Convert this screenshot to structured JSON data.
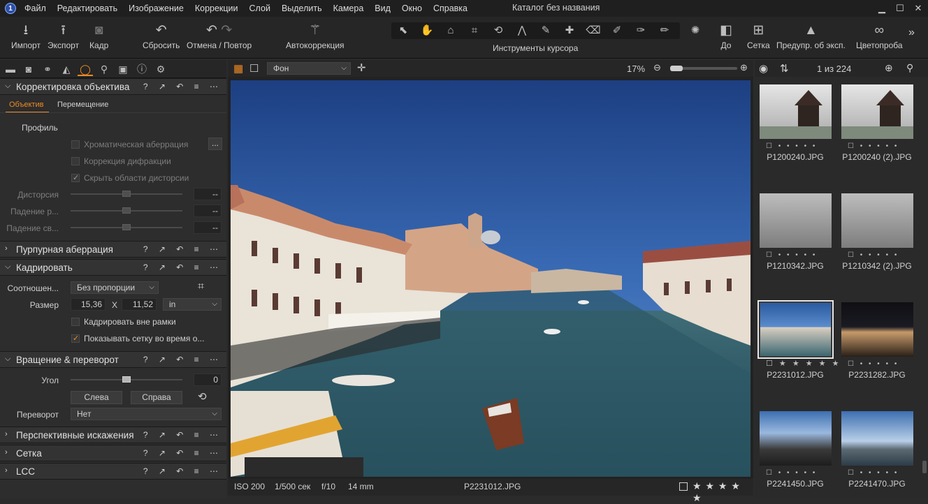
{
  "app": {
    "title": "Каталог без названия",
    "logo": "1"
  },
  "menu": [
    "Файл",
    "Редактировать",
    "Изображение",
    "Коррекции",
    "Слой",
    "Выделить",
    "Камера",
    "Вид",
    "Окно",
    "Справка"
  ],
  "toolbar": {
    "import": "Импорт",
    "export": "Экспорт",
    "capture": "Кадр",
    "reset": "Сбросить",
    "undo_redo": "Отмена / Повтор",
    "autocorrect": "Автокоррекция",
    "cursor_tools": "Инструменты курсора",
    "before": "До",
    "grid": "Сетка",
    "exposure_warning": "Предупр. об эксп.",
    "color_picker": "Цветопроба"
  },
  "left": {
    "lens": {
      "title": "Корректировка объектива",
      "tab_lens": "Объектив",
      "tab_move": "Перемещение",
      "profile": "Профиль",
      "chromatic": "Хроматическая аберрация",
      "diffraction": "Коррекция дифракции",
      "hide_distortion": "Скрыть области дисторсии",
      "distortion": "Дисторсия",
      "falloff_r": "Падение р...",
      "falloff_l": "Падение св...",
      "value_dash": "--",
      "more_btn": "..."
    },
    "purple": {
      "title": "Пурпурная аберрация"
    },
    "crop": {
      "title": "Кадрировать",
      "ratio_label": "Соотношен...",
      "ratio_value": "Без пропорции",
      "size_label": "Размер",
      "width": "15,36",
      "x": "X",
      "height": "11,52",
      "unit": "in",
      "crop_outside": "Кадрировать вне рамки",
      "show_grid": "Показывать сетку во время о..."
    },
    "rotation": {
      "title": "Вращение & переворот",
      "angle_label": "Угол",
      "angle_value": "0",
      "left_btn": "Слева",
      "right_btn": "Справа",
      "flip_label": "Переворот",
      "flip_value": "Нет"
    },
    "perspective": {
      "title": "Перспективные искажения"
    },
    "grid": {
      "title": "Сетка"
    },
    "lcc": {
      "title": "LCC"
    },
    "ctrl_icons": "? ↗ ↶ ≡ ⋯"
  },
  "viewer": {
    "bg_select": "Фон",
    "zoom": "17%",
    "iso": "ISO 200",
    "shutter": "1/500 сек",
    "aperture": "f/10",
    "focal": "14 mm",
    "filename": "P2231012.JPG",
    "stars": "★ ★ ★ ★ ★"
  },
  "browser": {
    "counter": "1 из 224",
    "meta": "☐ • • • • •",
    "meta_sel": "☐ ★ ★ ★ ★ ★",
    "items": [
      "P1200240.JPG",
      "P1200240 (2).JPG",
      "P1210342.JPG",
      "P1210342 (2).JPG",
      "P2231012.JPG",
      "P2231282.JPG",
      "P2241450.JPG",
      "P2241470.JPG"
    ]
  },
  "colors": {
    "accent": "#f08a24",
    "bg": "#2b2b2b"
  }
}
